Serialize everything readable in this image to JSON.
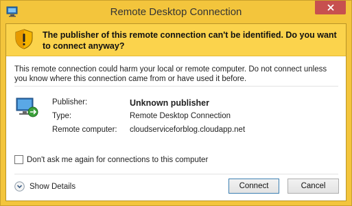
{
  "window": {
    "title": "Remote Desktop Connection",
    "close_label": "×"
  },
  "warning": {
    "heading": "The publisher of this remote connection can't be identified. Do you want to connect anyway?"
  },
  "message": "This remote connection could harm your local or remote computer. Do not connect unless you know where this connection came from or have used it before.",
  "details": {
    "publisher_label": "Publisher:",
    "publisher_value": "Unknown publisher",
    "type_label": "Type:",
    "type_value": "Remote Desktop Connection",
    "remote_label": "Remote computer:",
    "remote_value": "cloudserviceforblog.cloudapp.net"
  },
  "checkbox": {
    "label": "Don't ask me again for connections to this computer",
    "checked": false
  },
  "footer": {
    "show_details_label": "Show Details",
    "connect_label": "Connect",
    "cancel_label": "Cancel"
  },
  "colors": {
    "frame": "#f3c53c",
    "warning_band": "#fbd34c",
    "close_button": "#c7504f"
  },
  "icons": {
    "app": "remote-desktop-icon",
    "warning": "shield-warning-icon",
    "computer": "remote-computer-icon",
    "expand": "chevron-down-icon",
    "close": "close-icon"
  }
}
